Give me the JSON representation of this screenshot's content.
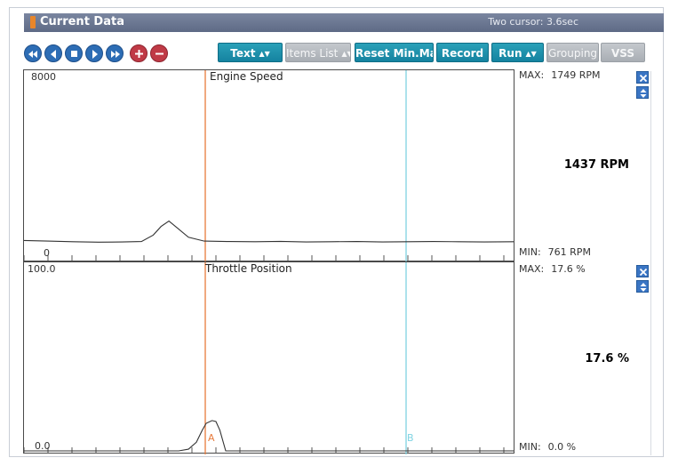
{
  "window": {
    "title": "Current Data",
    "status": "Two cursor: 3.6sec"
  },
  "toolbar": {
    "nav_buttons": [
      "rewind-icon",
      "step-back-icon",
      "stop-icon",
      "play-icon",
      "fast-forward-icon",
      "zoom-in-icon",
      "zoom-out-icon"
    ],
    "text_select": "Text",
    "items_list": "Items List",
    "reset_minmax": "Reset Min.Max",
    "record": "Record",
    "run_select": "Run",
    "grouping": "Grouping",
    "vss": "VSS"
  },
  "colors": {
    "title_bar": "#6b7691",
    "button_teal": "#1e8fab",
    "button_disabled": "#b4b9be",
    "nav_blue": "#2d6db5",
    "nav_red": "#c03a46",
    "cursor_a": "#e87b3c",
    "cursor_b": "#7fd3e2"
  },
  "cursors": {
    "a_label": "A",
    "b_label": "B"
  },
  "charts": [
    {
      "title": "Engine Speed",
      "ymax_label": "8000",
      "ymin_label": "0",
      "stats": {
        "max_label": "MAX:",
        "max_value": "1749 RPM",
        "min_label": "MIN:",
        "min_value": "761 RPM",
        "current": "1437 RPM"
      }
    },
    {
      "title": "Throttle Position",
      "ymax_label": "100.0",
      "ymin_label": "0.0",
      "stats": {
        "max_label": "MAX:",
        "max_value": "17.6 %",
        "min_label": "MIN:",
        "min_value": "0.0 %",
        "current": "17.6 %"
      }
    }
  ],
  "chart_data": [
    {
      "type": "line",
      "title": "Engine Speed",
      "ylim": [
        0,
        8000
      ],
      "x": [
        0,
        12,
        25,
        38,
        50,
        60,
        66,
        70,
        74,
        78,
        84,
        92,
        105,
        118,
        131,
        144,
        157,
        170,
        183,
        196,
        209,
        222,
        235,
        250
      ],
      "values": [
        850,
        820,
        790,
        770,
        780,
        800,
        1100,
        1500,
        1749,
        1450,
        1000,
        820,
        800,
        790,
        810,
        780,
        790,
        800,
        780,
        790,
        800,
        790,
        780,
        790
      ]
    },
    {
      "type": "line",
      "title": "Throttle Position",
      "ylim": [
        0,
        100
      ],
      "x": [
        0,
        40,
        79,
        84,
        88,
        91,
        93,
        96,
        98,
        100,
        103,
        110,
        150,
        200,
        250
      ],
      "values": [
        0,
        0,
        0,
        1,
        5,
        12,
        16,
        17.6,
        17,
        12,
        0,
        0,
        0,
        0,
        0
      ]
    }
  ]
}
